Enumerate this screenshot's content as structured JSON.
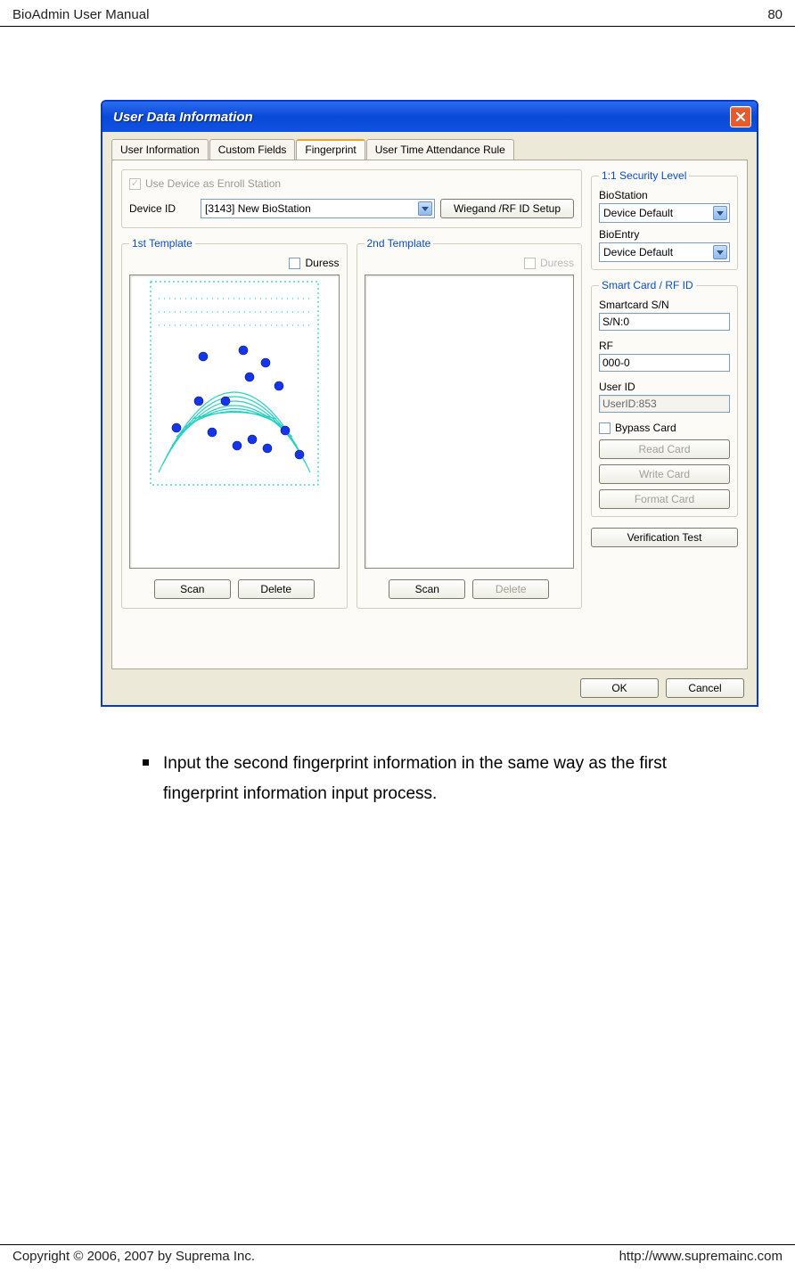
{
  "header": {
    "title": "BioAdmin User Manual",
    "page": "80"
  },
  "footer": {
    "copyright": "Copyright © 2006, 2007 by Suprema Inc.",
    "url": "http://www.supremainc.com"
  },
  "dialog": {
    "title": "User Data Information",
    "tabs": [
      "User Information",
      "Custom Fields",
      "Fingerprint",
      "User Time Attendance Rule"
    ],
    "active_tab": 2,
    "enroll_station": {
      "chk_label": "Use Device as Enroll Station",
      "checked": true,
      "device_label": "Device ID",
      "device_value": "[3143] New BioStation",
      "wiegand_btn": "Wiegand /RF ID Setup"
    },
    "template1": {
      "legend": "1st Template",
      "duress_label": "Duress",
      "duress_checked": false,
      "scan_btn": "Scan",
      "delete_btn": "Delete"
    },
    "template2": {
      "legend": "2nd Template",
      "duress_label": "Duress",
      "duress_checked": false,
      "scan_btn": "Scan",
      "delete_btn": "Delete"
    },
    "security": {
      "legend": "1:1 Security Level",
      "biostation_label": "BioStation",
      "biostation_value": "Device Default",
      "bioentry_label": "BioEntry",
      "bioentry_value": "Device Default"
    },
    "smartcard": {
      "legend": "Smart Card / RF ID",
      "sn_label": "Smartcard S/N",
      "sn_value": "S/N:0",
      "rf_label": "RF",
      "rf_value": "000-0",
      "userid_label": "User ID",
      "userid_value": "UserID:853",
      "bypass_label": "Bypass Card",
      "bypass_checked": false,
      "read_btn": "Read Card",
      "write_btn": "Write Card",
      "format_btn": "Format Card"
    },
    "verify_btn": "Verification Test",
    "ok_btn": "OK",
    "cancel_btn": "Cancel"
  },
  "body_text": "Input the second fingerprint information in the same way as the first fingerprint information input process."
}
